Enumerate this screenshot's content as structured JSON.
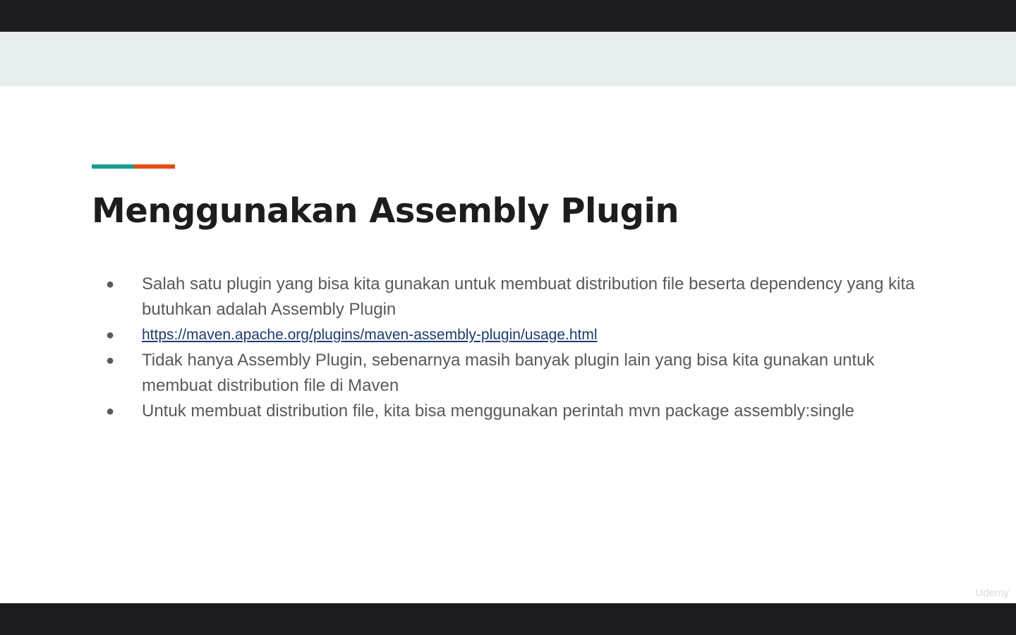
{
  "slide": {
    "title": "Menggunakan Assembly Plugin",
    "accent_colors": {
      "teal": "#13a08f",
      "orange": "#f04a0a"
    },
    "bullets": [
      "Salah satu plugin yang bisa kita gunakan untuk membuat distribution file beserta dependency yang kita butuhkan adalah Assembly Plugin",
      "https://maven.apache.org/plugins/maven-assembly-plugin/usage.html",
      "Tidak hanya Assembly Plugin, sebenarnya masih banyak plugin lain yang bisa kita gunakan untuk membuat distribution file di Maven",
      "Untuk membuat distribution file, kita bisa menggunakan perintah mvn package assembly:single"
    ],
    "bullet_symbol": "●"
  },
  "watermark": "Udemy"
}
